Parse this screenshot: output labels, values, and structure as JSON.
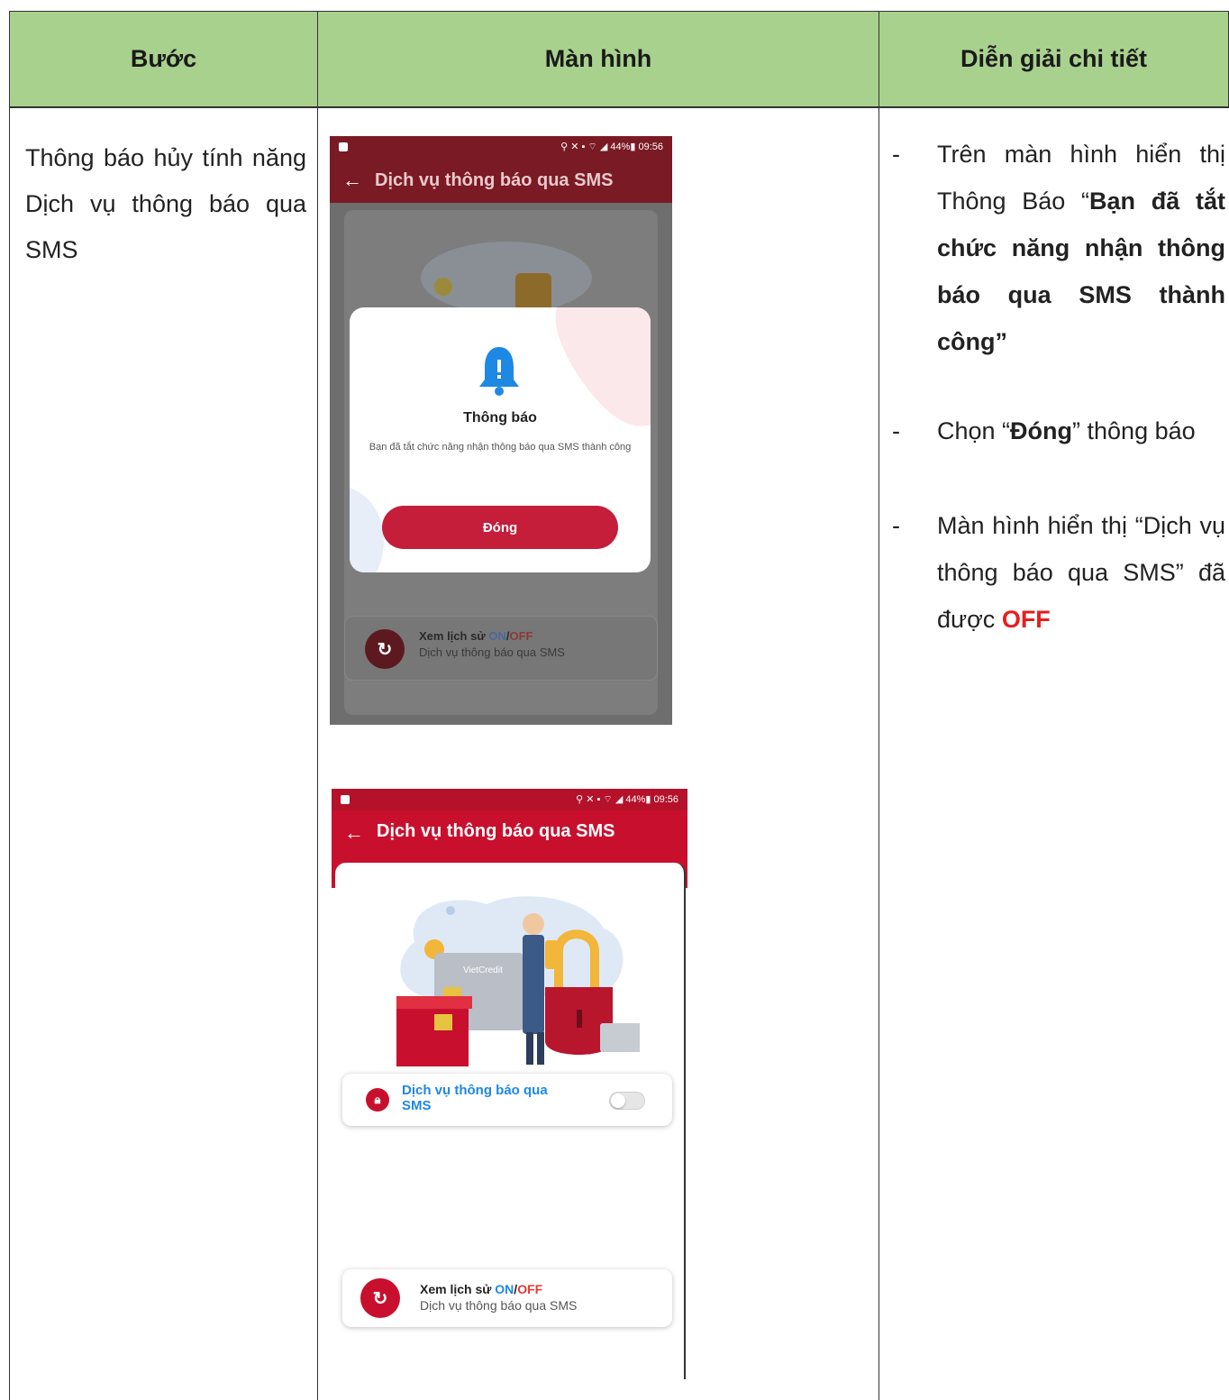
{
  "table": {
    "headers": [
      "Bước",
      "Màn hình",
      "Diễn giải chi tiết"
    ]
  },
  "step": {
    "text": "Thông báo hủy tính năng Dịch vụ thông báo qua SMS"
  },
  "details": [
    {
      "dash": "-",
      "pre": "Trên màn hình hiển thị Thông Báo “",
      "bold": "Bạn đã tắt chức năng nhận thông báo qua SMS thành công”",
      "post": ""
    },
    {
      "dash": "-",
      "pre": "Chọn “",
      "bold": "Đóng",
      "post": "” thông báo"
    },
    {
      "dash": "-",
      "pre": "Màn hình hiển thị “Dịch vụ thông báo qua SMS” đã được ",
      "red": "OFF"
    }
  ],
  "phone1": {
    "status_right": "⚲ ✕ ▪ ⌔ ◢ 44%▮ 09:56",
    "back": "←",
    "title": "Dịch vụ thông báo qua SMS",
    "modal": {
      "title": "Thông báo",
      "message": "Bạn đã tắt chức năng nhận thông báo qua SMS thành công",
      "button": "Đóng"
    },
    "history": {
      "label": "Xem lịch sử ",
      "on": "ON",
      "sep": "/",
      "off": "OFF",
      "sub": "Dịch vụ thông báo qua SMS"
    }
  },
  "phone2": {
    "status_right": "⚲ ✕ ▪ ⌔ ◢ 44%▮ 09:56",
    "back": "←",
    "title": "Dịch vụ thông báo qua SMS",
    "illustration_card_text": "VietCredit",
    "toggle_label": "Dịch vụ thông báo qua SMS",
    "toggle_on": false,
    "history": {
      "label": "Xem lịch sử ",
      "on": "ON",
      "sep": "/",
      "off": "OFF",
      "sub": "Dịch vụ thông báo qua SMS"
    }
  },
  "colors": {
    "header": "#a9d18e",
    "brand_red": "#c8102e",
    "off_red": "#e61e1e"
  }
}
